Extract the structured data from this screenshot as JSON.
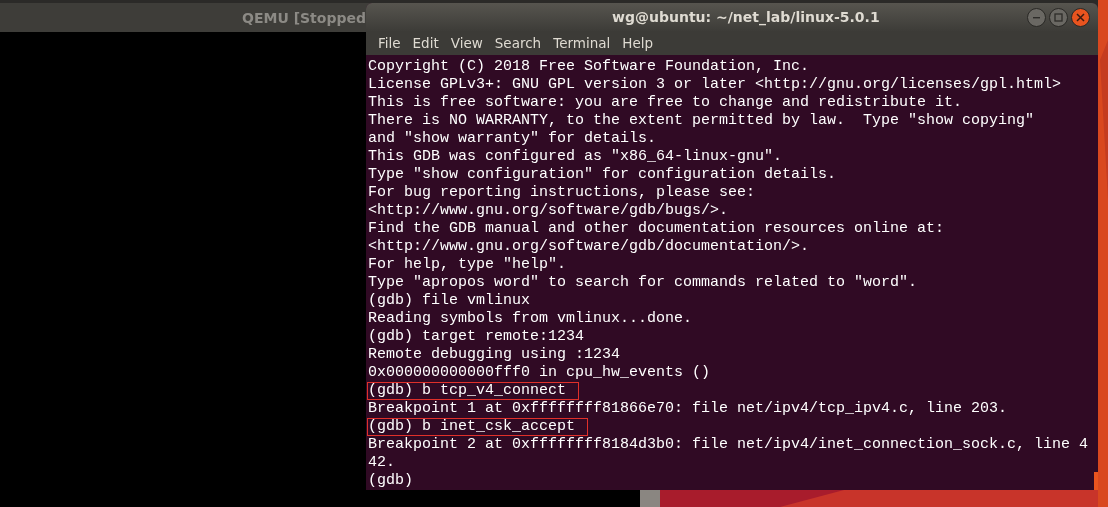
{
  "qemu_window": {
    "title": "QEMU [Stopped"
  },
  "terminal": {
    "title": "wg@ubuntu: ~/net_lab/linux-5.0.1",
    "menu": [
      "File",
      "Edit",
      "View",
      "Search",
      "Terminal",
      "Help"
    ],
    "lines": [
      {
        "text": "Copyright (C) 2018 Free Software Foundation, Inc.",
        "boxed": false
      },
      {
        "text": "License GPLv3+: GNU GPL version 3 or later <http://gnu.org/licenses/gpl.html>",
        "boxed": false
      },
      {
        "text": "This is free software: you are free to change and redistribute it.",
        "boxed": false
      },
      {
        "text": "There is NO WARRANTY, to the extent permitted by law.  Type \"show copying\"",
        "boxed": false
      },
      {
        "text": "and \"show warranty\" for details.",
        "boxed": false
      },
      {
        "text": "This GDB was configured as \"x86_64-linux-gnu\".",
        "boxed": false
      },
      {
        "text": "Type \"show configuration\" for configuration details.",
        "boxed": false
      },
      {
        "text": "For bug reporting instructions, please see:",
        "boxed": false
      },
      {
        "text": "<http://www.gnu.org/software/gdb/bugs/>.",
        "boxed": false
      },
      {
        "text": "Find the GDB manual and other documentation resources online at:",
        "boxed": false
      },
      {
        "text": "<http://www.gnu.org/software/gdb/documentation/>.",
        "boxed": false
      },
      {
        "text": "For help, type \"help\".",
        "boxed": false
      },
      {
        "text": "Type \"apropos word\" to search for commands related to \"word\".",
        "boxed": false
      },
      {
        "text": "(gdb) file vmlinux",
        "boxed": false
      },
      {
        "text": "Reading symbols from vmlinux...done.",
        "boxed": false
      },
      {
        "text": "(gdb) target remote:1234",
        "boxed": false
      },
      {
        "text": "Remote debugging using :1234",
        "boxed": false
      },
      {
        "text": "0x000000000000fff0 in cpu_hw_events ()",
        "boxed": false
      },
      {
        "text": "(gdb) b tcp_v4_connect",
        "boxed": true
      },
      {
        "text": "Breakpoint 1 at 0xffffffff81866e70: file net/ipv4/tcp_ipv4.c, line 203.",
        "boxed": false
      },
      {
        "text": "(gdb) b inet_csk_accept",
        "boxed": true
      },
      {
        "text": "Breakpoint 2 at 0xffffffff8184d3b0: file net/ipv4/inet_connection_sock.c, line 4",
        "boxed": false
      },
      {
        "text": "42.",
        "boxed": false
      },
      {
        "text": "(gdb)",
        "boxed": false
      }
    ]
  }
}
